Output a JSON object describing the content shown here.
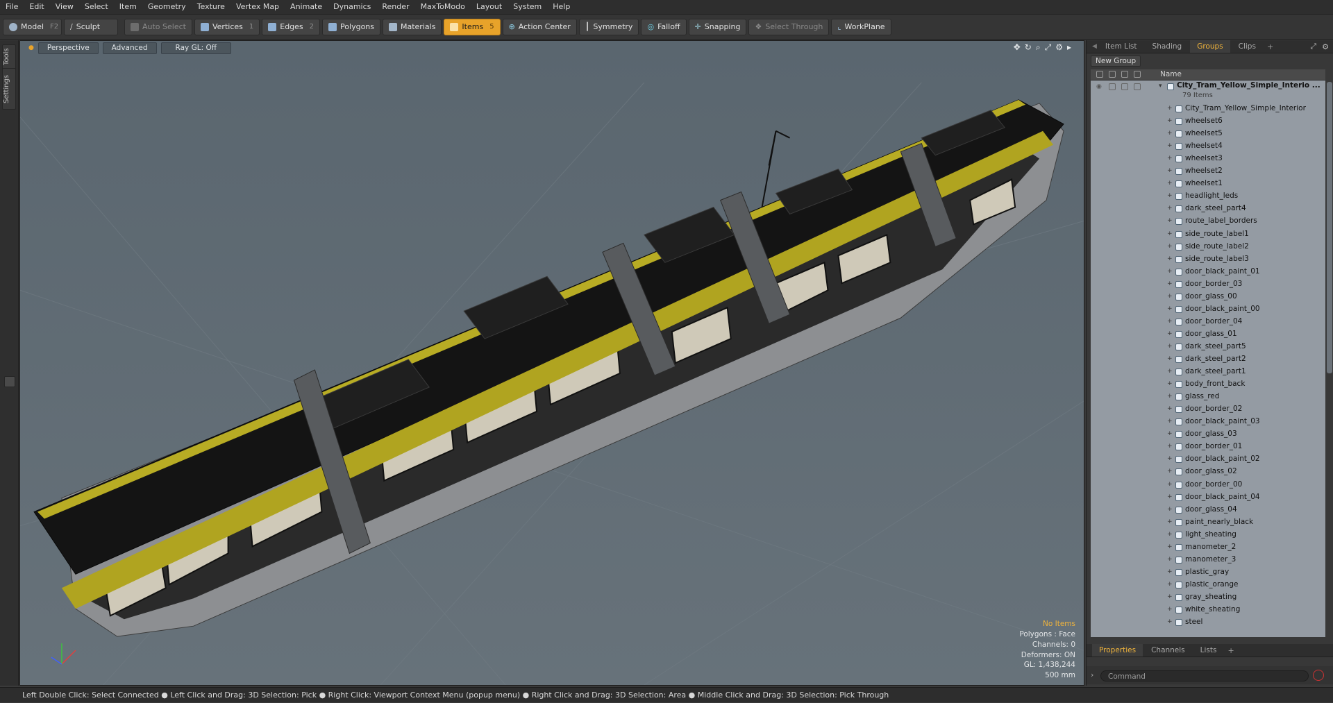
{
  "menu": [
    "File",
    "Edit",
    "View",
    "Select",
    "Item",
    "Geometry",
    "Texture",
    "Vertex Map",
    "Animate",
    "Dynamics",
    "Render",
    "MaxToModo",
    "Layout",
    "System",
    "Help"
  ],
  "toolbar": {
    "model_label": "Model",
    "model_key": "F2",
    "sculpt_label": "Sculpt",
    "auto_select_label": "Auto Select",
    "vertices_label": "Vertices",
    "vertices_key": "1",
    "edges_label": "Edges",
    "edges_key": "2",
    "polygons_label": "Polygons",
    "materials_label": "Materials",
    "items_label": "Items",
    "items_key": "5",
    "action_center_label": "Action Center",
    "symmetry_label": "Symmetry",
    "falloff_label": "Falloff",
    "snapping_label": "Snapping",
    "select_through_label": "Select Through",
    "workplane_label": "WorkPlane",
    "accent": "#e8a32a"
  },
  "left_tabs": {
    "tools": "Tools",
    "settings": "Settings"
  },
  "viewport": {
    "tabs": {
      "view": "Perspective",
      "shading": "Advanced",
      "raygl": "Ray GL: Off"
    },
    "background": "#5e6a72",
    "info": {
      "selection": "No Items",
      "polygons": "Polygons : Face",
      "channels": "Channels: 0",
      "deformers": "Deformers: ON",
      "gl": "GL: 1,438,244",
      "scale": "500 mm"
    }
  },
  "right_panel": {
    "tabs": {
      "item_list": "Item List",
      "shading": "Shading",
      "groups": "Groups",
      "clips": "Clips"
    },
    "new_group": "New Group",
    "column_name": "Name",
    "group": {
      "name": "City_Tram_Yellow_Simple_Interio ...",
      "count": "79 Items"
    },
    "items": [
      "City_Tram_Yellow_Simple_Interior",
      "wheelset6",
      "wheelset5",
      "wheelset4",
      "wheelset3",
      "wheelset2",
      "wheelset1",
      "headlight_leds",
      "dark_steel_part4",
      "route_label_borders",
      "side_route_label1",
      "side_route_label2",
      "side_route_label3",
      "door_black_paint_01",
      "door_border_03",
      "door_glass_00",
      "door_black_paint_00",
      "door_border_04",
      "door_glass_01",
      "dark_steel_part5",
      "dark_steel_part2",
      "dark_steel_part1",
      "body_front_back",
      "glass_red",
      "door_border_02",
      "door_black_paint_03",
      "door_glass_03",
      "door_border_01",
      "door_black_paint_02",
      "door_glass_02",
      "door_border_00",
      "door_black_paint_04",
      "door_glass_04",
      "paint_nearly_black",
      "light_sheating",
      "manometer_2",
      "manometer_3",
      "plastic_gray",
      "plastic_orange",
      "gray_sheating",
      "white_sheating",
      "steel"
    ],
    "bottom_tabs": {
      "properties": "Properties",
      "channels": "Channels",
      "lists": "Lists"
    },
    "command_placeholder": "Command"
  },
  "status": "Left Double Click: Select Connected ● Left Click and Drag: 3D Selection: Pick ● Right Click: Viewport Context Menu (popup menu) ● Right Click and Drag: 3D Selection: Area ● Middle Click and Drag: 3D Selection: Pick Through"
}
